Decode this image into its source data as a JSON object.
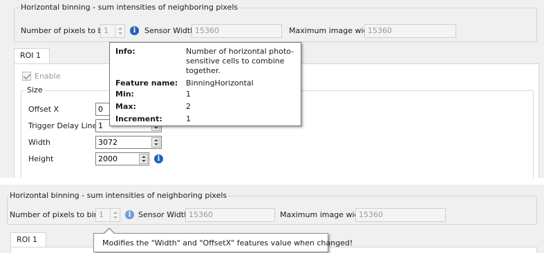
{
  "top": {
    "binning_group_title": "Horizontal binning - sum intensities of neighboring pixels",
    "pixels_to_bin_label": "Number of pixels to bin",
    "pixels_to_bin_value": "1",
    "sensor_width_label": "Sensor Width",
    "sensor_width_value": "15360",
    "max_image_width_label": "Maximum image width",
    "max_image_width_value": "15360",
    "tab_label": "ROI 1",
    "enable_label": "Enable",
    "size_group_title": "Size",
    "fields": [
      {
        "label": "Offset X",
        "value": "0"
      },
      {
        "label": "Trigger Delay Lines",
        "value": "1"
      },
      {
        "label": "Width",
        "value": "3072"
      },
      {
        "label": "Height",
        "value": "2000"
      }
    ],
    "tooltip": {
      "info_key": "Info:",
      "info_lines": [
        "Number of horizontal photo-",
        "sensitive cells to combine",
        "together."
      ],
      "feature_key": "Feature name:",
      "feature_val": "BinningHorizontal",
      "min_key": "Min:",
      "min_val": "1",
      "max_key": "Max:",
      "max_val": "2",
      "inc_key": "Increment:",
      "inc_val": "1"
    }
  },
  "bottom": {
    "binning_group_title": "Horizontal binning - sum intensities of neighboring pixels",
    "pixels_to_bin_label": "Number of pixels to bin",
    "pixels_to_bin_value": "1",
    "sensor_width_label": "Sensor Width",
    "sensor_width_value": "15360",
    "max_image_width_label": "Maximum image width",
    "max_image_width_value": "15360",
    "tab_label": "ROI 1",
    "tooltip_text": "Modifies the \"Width\" and \"OffsetX\" features value when changed!"
  },
  "icons": {
    "info": "info-icon",
    "spin_arrows": "spin-arrows-icon",
    "check": "checkmark-icon"
  },
  "colors": {
    "panel_bg": "#f0f0f0",
    "info_icon": "#1f64b8",
    "border": "#d5d5d5"
  }
}
